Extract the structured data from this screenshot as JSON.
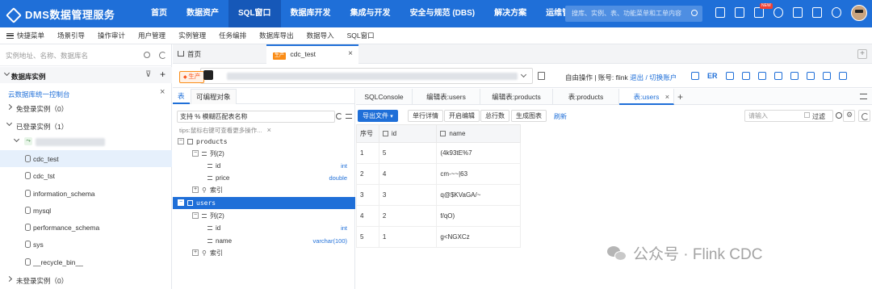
{
  "app": {
    "logo_text": "DMS数据管理服务",
    "nav": [
      "首页",
      "数据资产",
      "SQL窗口",
      "数据库开发",
      "集成与开发",
      "安全与规范 (DBS)",
      "解决方案",
      "运维管理"
    ],
    "active_nav": "SQL窗口",
    "search_placeholder": "搜库、实例、表、功能菜单和工单内容",
    "new_badge": "NEW"
  },
  "submenu": [
    "快捷菜单",
    "场景引导",
    "操作审计",
    "用户管理",
    "实例管理",
    "任务编排",
    "数据库导出",
    "数据导入",
    "SQL窗口"
  ],
  "sidebar": {
    "search_placeholder": "实例地址、名称、数据库名",
    "section_title": "数据库实例",
    "console_link": "云数据库统一控制台",
    "free_login": "免登录实例（0）",
    "logged_in": "已登录实例（1）",
    "instance_label": "",
    "databases": [
      "cdc_test",
      "cdc_tst",
      "information_schema",
      "mysql",
      "performance_schema",
      "sys",
      "__recycle_bin__"
    ],
    "selected_db": "cdc_test",
    "not_logged": "未登录实例（0）"
  },
  "page_tabs": {
    "home": "首页",
    "current_tag": "生产",
    "current": "cdc_test"
  },
  "connection": {
    "env_label": "生产",
    "mode_prefix": "自由操作 | 账号: flink",
    "logout": "退出 / 切换账户",
    "er_label": "ER"
  },
  "object_panel": {
    "tabs": [
      "表",
      "可编程对象"
    ],
    "search_value": "支持 % 模糊匹配表名称",
    "tips": "tips:鼠标右键可查看更多操作...",
    "tables": [
      {
        "name": "products",
        "cols_label": "列(2)",
        "columns": [
          {
            "name": "id",
            "type": "int"
          },
          {
            "name": "price",
            "type": "double"
          }
        ],
        "index_label": "索引"
      },
      {
        "name": "users",
        "cols_label": "列(2)",
        "columns": [
          {
            "name": "id",
            "type": "int"
          },
          {
            "name": "name",
            "type": "varchar(100)"
          }
        ],
        "index_label": "索引"
      }
    ]
  },
  "query_tabs": [
    "SQLConsole",
    "编辑表:users",
    "编辑表:products",
    "表:products",
    "表:users"
  ],
  "active_query_tab": "表:users",
  "result_toolbar": {
    "export": "导出文件",
    "buttons": [
      "单行详情",
      "开启编辑",
      "总行数",
      "生成图表"
    ],
    "refresh": "刷新",
    "input_placeholder": "请输入",
    "filter": "过滤"
  },
  "result_grid": {
    "headers": [
      "序号",
      "id",
      "name"
    ],
    "rows": [
      [
        "1",
        "5",
        "(4k93tE%7"
      ],
      [
        "2",
        "4",
        "cm-~~|63"
      ],
      [
        "3",
        "3",
        "q@$KVaGA/~"
      ],
      [
        "4",
        "2",
        "f/qO)"
      ],
      [
        "5",
        "1",
        "g<NGXCz"
      ]
    ]
  },
  "watermark": "公众号 · Flink CDC",
  "colors": {
    "primary": "#1f6fd8",
    "env_orange": "#fa8c16"
  }
}
